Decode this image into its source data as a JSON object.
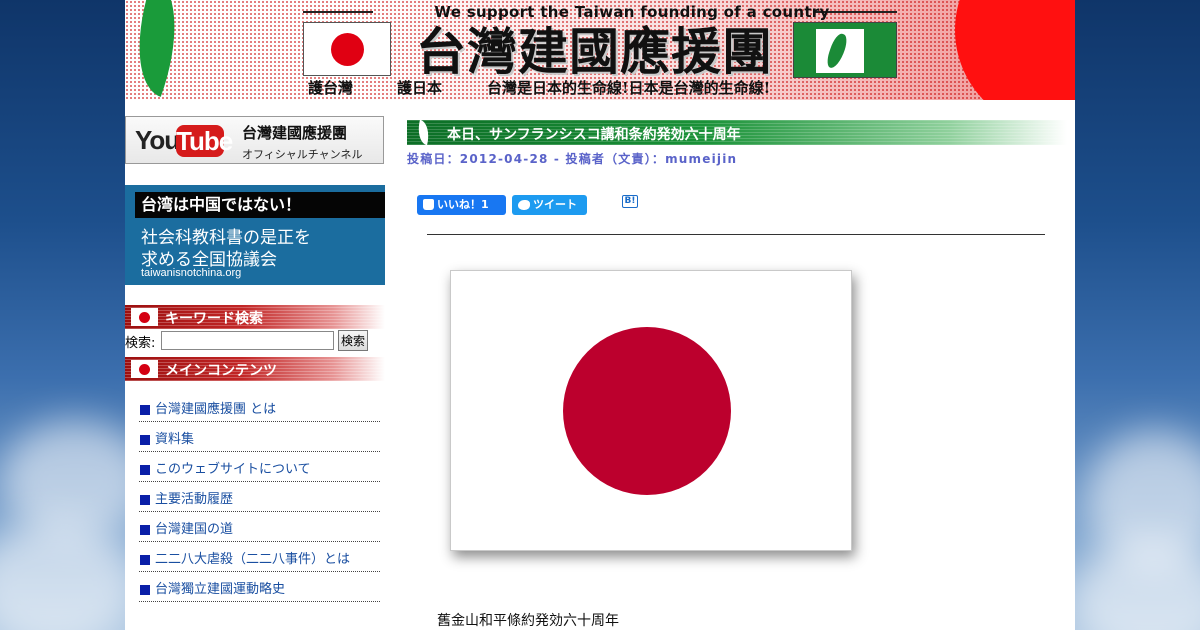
{
  "header": {
    "slogan_top": "We support the Taiwan founding of a country",
    "title": "台灣建國應援團",
    "sub_1": "護台灣",
    "sub_2": "護日本",
    "sub_3": "台灣是日本的生命線!日本是台灣的生命線!"
  },
  "sidebar": {
    "youtube": {
      "logo_you": "You",
      "logo_tube": "Tube",
      "channel_name": "台灣建國應援團",
      "channel_sub": "オフィシャルチャンネル"
    },
    "banner": {
      "top": "台湾は中国ではない！",
      "line_1": "社会科教科書の是正を",
      "line_2": "求める全国協議会",
      "url": "taiwanisnotchina.org"
    },
    "search": {
      "heading": "キーワード検索",
      "label": "検索:",
      "value": "",
      "button": "検索"
    },
    "menu": {
      "heading": "メインコンテンツ",
      "items": [
        {
          "label": "台灣建國應援團 とは"
        },
        {
          "label": "資料集"
        },
        {
          "label": "このウェブサイトについて"
        },
        {
          "label": "主要活動履歴"
        },
        {
          "label": "台灣建国の道"
        },
        {
          "label": "二二八大虐殺（二二八事件）とは"
        },
        {
          "label": "台灣獨立建國運動略史"
        }
      ]
    }
  },
  "article": {
    "title": "本日、サンフランシスコ講和条約発効六十周年",
    "meta": "投稿日：2012-04-28 - 投稿者（文責）：mumeijin",
    "share": {
      "like_label": "いいね！1",
      "tweet_label": "ツイート",
      "hatena_label": "B!"
    },
    "caption": "舊金山和平條約発効六十周年"
  },
  "colors": {
    "flag_red": "#bc002d",
    "title_bar_green": "#1a9238",
    "section_red": "#c22626",
    "link_blue": "#1a4fa1",
    "meta_purple": "#5a63c9"
  }
}
